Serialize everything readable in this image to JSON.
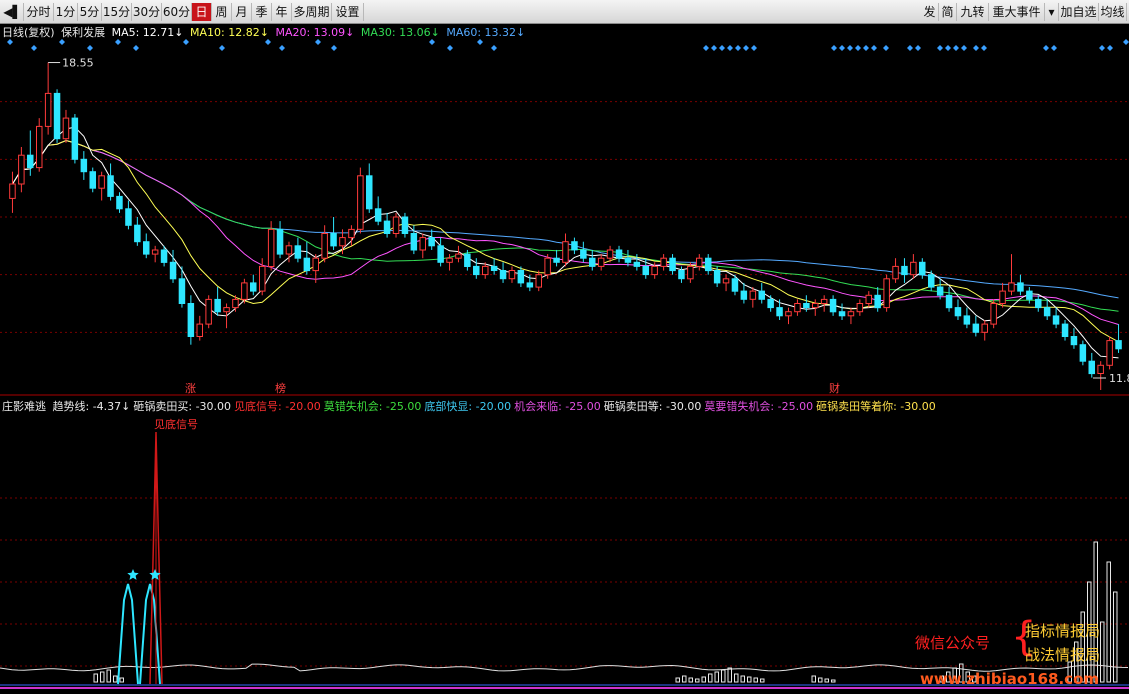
{
  "toolbar": {
    "left": [
      {
        "label": "◀▌",
        "name": "back-icon"
      },
      {
        "label": "分时"
      },
      {
        "label": "1分"
      },
      {
        "label": "5分"
      },
      {
        "label": "15分"
      },
      {
        "label": "30分"
      },
      {
        "label": "60分"
      },
      {
        "label": "日",
        "active": true
      },
      {
        "label": "周"
      },
      {
        "label": "月"
      },
      {
        "label": "季"
      },
      {
        "label": "年"
      },
      {
        "label": "多周期"
      },
      {
        "label": "设置"
      }
    ],
    "right": [
      {
        "label": "发"
      },
      {
        "label": "简"
      },
      {
        "label": "九转"
      },
      {
        "label": "重大事件"
      },
      {
        "label": "▾",
        "name": "dropdown-icon"
      },
      {
        "label": "加自选"
      },
      {
        "label": "均线"
      }
    ]
  },
  "main_header": {
    "period": "日线(复权)",
    "stock": "保利发展",
    "ma5": "MA5: 12.71↓",
    "ma10": "MA10: 12.82↓",
    "ma20": "MA20: 13.09↓",
    "ma30": "MA30: 13.06↓",
    "ma60": "MA60: 13.32↓"
  },
  "price_labels": {
    "high": "18.55",
    "low": "11.8"
  },
  "event_markers": [
    "涨",
    "榜",
    "财"
  ],
  "indicator_header": {
    "name": "庄影难逃",
    "items": [
      {
        "text": "趋势线: -4.37↓",
        "color": "#e8e8e8"
      },
      {
        "text": "砸锅卖田买: -30.00",
        "color": "#e8e8e8"
      },
      {
        "text": "见底信号: -20.00",
        "color": "#ff3030"
      },
      {
        "text": "莫错失机会: -25.00",
        "color": "#3ddc3d"
      },
      {
        "text": "底部快显: -20.00",
        "color": "#3ec8f0"
      },
      {
        "text": "机会来临: -25.00",
        "color": "#e050e0"
      },
      {
        "text": "砸锅卖田等: -30.00",
        "color": "#e8e8e8"
      },
      {
        "text": "莫要错失机会: -25.00",
        "color": "#e050e0"
      },
      {
        "text": "砸锅卖田等着你: -30.00",
        "color": "#ffe14d"
      }
    ]
  },
  "signal_label": "见底信号",
  "watermark": {
    "left": "微信公众号",
    "right1": "指标情报局",
    "right2": "战法情报局",
    "url": "www.zhibiao168.com"
  },
  "colors": {
    "up": "#ff3b3b",
    "down": "#2ee6ff",
    "ma5": "#ffffff",
    "ma10": "#ffff55",
    "ma20": "#ff55ff",
    "ma30": "#33dd55",
    "ma60": "#55aaff",
    "grid": "#7a0000",
    "diamond": "#3aa0ff"
  },
  "chart_data": {
    "type": "candlestick",
    "price_range": [
      11.8,
      18.55
    ],
    "candles": [
      [
        15.25,
        15.9,
        14.9,
        15.6
      ],
      [
        15.6,
        16.5,
        15.4,
        16.3
      ],
      [
        16.3,
        16.9,
        15.8,
        16.0
      ],
      [
        16.0,
        17.2,
        15.9,
        17.0
      ],
      [
        17.0,
        18.55,
        16.8,
        17.8
      ],
      [
        17.8,
        17.9,
        16.6,
        16.7
      ],
      [
        16.7,
        17.4,
        16.6,
        17.2
      ],
      [
        17.2,
        17.3,
        16.1,
        16.2
      ],
      [
        16.2,
        16.4,
        15.7,
        15.9
      ],
      [
        15.9,
        16.0,
        15.4,
        15.5
      ],
      [
        15.5,
        15.9,
        15.2,
        15.8
      ],
      [
        15.8,
        16.1,
        15.2,
        15.3
      ],
      [
        15.3,
        15.4,
        14.9,
        15.0
      ],
      [
        15.0,
        15.2,
        14.5,
        14.6
      ],
      [
        14.6,
        14.8,
        14.1,
        14.2
      ],
      [
        14.2,
        14.4,
        13.8,
        13.9
      ],
      [
        13.9,
        14.1,
        13.7,
        14.0
      ],
      [
        14.0,
        14.1,
        13.6,
        13.7
      ],
      [
        13.7,
        14.0,
        13.2,
        13.3
      ],
      [
        13.3,
        13.6,
        12.6,
        12.7
      ],
      [
        12.7,
        12.9,
        11.7,
        11.9
      ],
      [
        11.9,
        12.4,
        11.8,
        12.2
      ],
      [
        12.2,
        12.9,
        12.1,
        12.8
      ],
      [
        12.8,
        13.1,
        12.4,
        12.5
      ],
      [
        12.5,
        12.7,
        12.1,
        12.6
      ],
      [
        12.6,
        12.9,
        12.5,
        12.8
      ],
      [
        12.8,
        13.3,
        12.7,
        13.2
      ],
      [
        13.2,
        13.4,
        12.9,
        13.0
      ],
      [
        13.0,
        13.8,
        12.9,
        13.6
      ],
      [
        13.6,
        14.7,
        13.5,
        14.5
      ],
      [
        14.5,
        14.7,
        13.8,
        13.9
      ],
      [
        13.9,
        14.2,
        13.7,
        14.1
      ],
      [
        14.1,
        14.3,
        13.7,
        13.8
      ],
      [
        13.8,
        14.2,
        13.4,
        13.5
      ],
      [
        13.5,
        13.9,
        13.2,
        13.8
      ],
      [
        13.8,
        14.6,
        13.7,
        14.4
      ],
      [
        14.4,
        14.8,
        14.0,
        14.1
      ],
      [
        14.1,
        14.5,
        13.9,
        14.3
      ],
      [
        14.3,
        14.6,
        14.1,
        14.5
      ],
      [
        14.5,
        16.0,
        14.4,
        15.8
      ],
      [
        15.8,
        16.1,
        14.9,
        15.0
      ],
      [
        15.0,
        15.3,
        14.6,
        14.7
      ],
      [
        14.7,
        14.9,
        14.3,
        14.4
      ],
      [
        14.4,
        14.9,
        14.3,
        14.8
      ],
      [
        14.8,
        14.9,
        14.3,
        14.4
      ],
      [
        14.4,
        14.6,
        13.9,
        14.0
      ],
      [
        14.0,
        14.4,
        13.8,
        14.3
      ],
      [
        14.3,
        14.5,
        14.0,
        14.1
      ],
      [
        14.1,
        14.3,
        13.6,
        13.7
      ],
      [
        13.7,
        13.9,
        13.5,
        13.8
      ],
      [
        13.8,
        14.1,
        13.7,
        13.9
      ],
      [
        13.9,
        14.0,
        13.5,
        13.6
      ],
      [
        13.6,
        13.8,
        13.3,
        13.4
      ],
      [
        13.4,
        13.7,
        13.3,
        13.6
      ],
      [
        13.6,
        13.8,
        13.4,
        13.5
      ],
      [
        13.5,
        13.7,
        13.2,
        13.3
      ],
      [
        13.3,
        13.6,
        13.2,
        13.5
      ],
      [
        13.5,
        13.6,
        13.1,
        13.2
      ],
      [
        13.2,
        13.4,
        13.0,
        13.1
      ],
      [
        13.1,
        13.5,
        13.0,
        13.4
      ],
      [
        13.4,
        13.9,
        13.3,
        13.8
      ],
      [
        13.8,
        14.0,
        13.6,
        13.7
      ],
      [
        13.7,
        14.4,
        13.6,
        14.2
      ],
      [
        14.2,
        14.3,
        13.9,
        14.0
      ],
      [
        14.0,
        14.2,
        13.7,
        13.8
      ],
      [
        13.8,
        14.0,
        13.5,
        13.6
      ],
      [
        13.6,
        13.9,
        13.5,
        13.8
      ],
      [
        13.8,
        14.1,
        13.7,
        14.0
      ],
      [
        14.0,
        14.1,
        13.7,
        13.8
      ],
      [
        13.8,
        14.0,
        13.6,
        13.7
      ],
      [
        13.7,
        13.9,
        13.5,
        13.6
      ],
      [
        13.6,
        13.8,
        13.3,
        13.4
      ],
      [
        13.4,
        13.7,
        13.3,
        13.6
      ],
      [
        13.6,
        13.9,
        13.5,
        13.8
      ],
      [
        13.8,
        13.9,
        13.4,
        13.5
      ],
      [
        13.5,
        13.6,
        13.2,
        13.3
      ],
      [
        13.3,
        13.7,
        13.2,
        13.6
      ],
      [
        13.6,
        13.9,
        13.5,
        13.8
      ],
      [
        13.8,
        13.9,
        13.4,
        13.5
      ],
      [
        13.5,
        13.6,
        13.1,
        13.2
      ],
      [
        13.2,
        13.4,
        13.0,
        13.3
      ],
      [
        13.3,
        13.4,
        12.9,
        13.0
      ],
      [
        13.0,
        13.2,
        12.7,
        12.8
      ],
      [
        12.8,
        13.1,
        12.6,
        13.0
      ],
      [
        13.0,
        13.2,
        12.7,
        12.8
      ],
      [
        12.8,
        12.9,
        12.5,
        12.6
      ],
      [
        12.6,
        12.8,
        12.3,
        12.4
      ],
      [
        12.4,
        12.6,
        12.2,
        12.5
      ],
      [
        12.5,
        12.8,
        12.4,
        12.7
      ],
      [
        12.7,
        12.9,
        12.5,
        12.6
      ],
      [
        12.6,
        12.8,
        12.4,
        12.7
      ],
      [
        12.7,
        12.9,
        12.5,
        12.8
      ],
      [
        12.8,
        12.9,
        12.4,
        12.5
      ],
      [
        12.5,
        12.7,
        12.3,
        12.4
      ],
      [
        12.4,
        12.6,
        12.2,
        12.5
      ],
      [
        12.5,
        12.8,
        12.4,
        12.7
      ],
      [
        12.7,
        13.0,
        12.6,
        12.9
      ],
      [
        12.9,
        13.1,
        12.5,
        12.6
      ],
      [
        12.6,
        13.4,
        12.5,
        13.3
      ],
      [
        13.3,
        13.8,
        13.2,
        13.6
      ],
      [
        13.6,
        13.8,
        13.2,
        13.4
      ],
      [
        13.4,
        13.9,
        13.3,
        13.7
      ],
      [
        13.7,
        13.8,
        13.3,
        13.4
      ],
      [
        13.4,
        13.5,
        13.0,
        13.1
      ],
      [
        13.1,
        13.3,
        12.8,
        12.9
      ],
      [
        12.9,
        13.1,
        12.5,
        12.6
      ],
      [
        12.6,
        12.8,
        12.3,
        12.4
      ],
      [
        12.4,
        12.6,
        12.1,
        12.2
      ],
      [
        12.2,
        12.4,
        11.9,
        12.0
      ],
      [
        12.0,
        12.3,
        11.8,
        12.2
      ],
      [
        12.2,
        12.8,
        12.1,
        12.7
      ],
      [
        12.7,
        13.2,
        12.6,
        13.0
      ],
      [
        13.0,
        13.9,
        12.9,
        13.2
      ],
      [
        13.2,
        13.4,
        12.9,
        13.0
      ],
      [
        13.0,
        13.1,
        12.7,
        12.8
      ],
      [
        12.8,
        12.9,
        12.5,
        12.6
      ],
      [
        12.6,
        12.8,
        12.3,
        12.4
      ],
      [
        12.4,
        12.6,
        12.1,
        12.2
      ],
      [
        12.2,
        12.3,
        11.8,
        11.9
      ],
      [
        11.9,
        12.1,
        11.6,
        11.7
      ],
      [
        11.7,
        11.8,
        11.2,
        11.3
      ],
      [
        11.3,
        11.5,
        10.9,
        11.0
      ],
      [
        11.0,
        11.3,
        10.6,
        11.2
      ],
      [
        11.2,
        11.9,
        11.1,
        11.8
      ],
      [
        11.8,
        12.2,
        11.5,
        11.6
      ]
    ]
  }
}
